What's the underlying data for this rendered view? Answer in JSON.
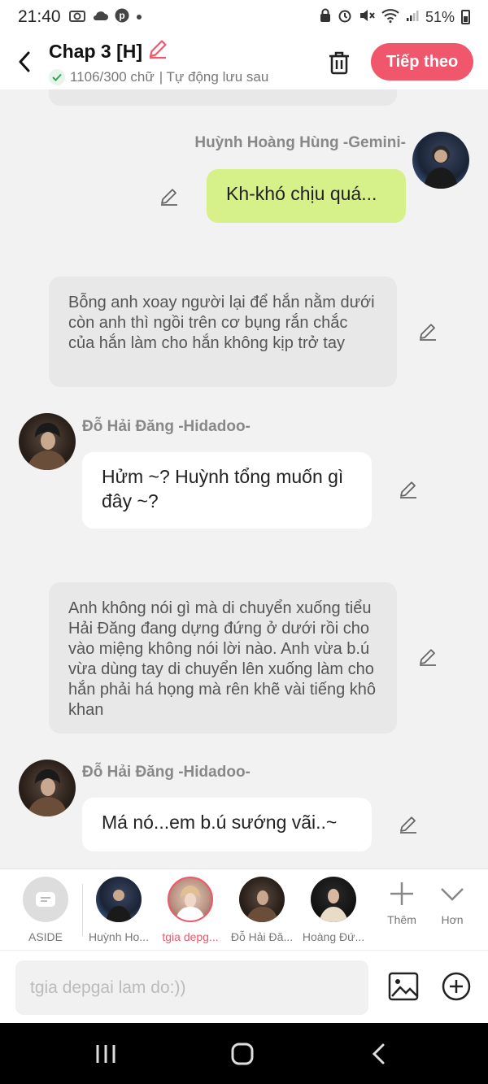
{
  "status_bar": {
    "time": "21:40",
    "battery": "51%"
  },
  "header": {
    "title": "Chap 3 [H]",
    "word_count": "1106/300 chữ",
    "autosave": "| Tự động lưu sau",
    "next_label": "Tiếp theo"
  },
  "messages": [
    {
      "type": "me",
      "name": "Huỳnh Hoàng Hùng -Gemini-",
      "text": "Kh-khó chịu quá..."
    },
    {
      "type": "narration",
      "text": "Bỗng anh xoay người lại để hắn nằm dưới còn anh thì ngồi trên cơ bụng rắn chắc của hắn làm cho hắn không kịp trở tay"
    },
    {
      "type": "other",
      "name": "Đỗ Hải Đăng -Hidadoo-",
      "text": "Hửm ~? Huỳnh tổng muốn gì đây ~?"
    },
    {
      "type": "narration",
      "text": "Anh không nói gì mà di chuyển xuống tiểu Hải Đăng đang dựng đứng ở dưới rồi cho vào miệng không nói lời nào. Anh vừa b.ú vừa dùng tay di chuyển lên xuống làm cho hắn phải há họng mà rên khẽ vài tiếng khô khan"
    },
    {
      "type": "other",
      "name": "Đỗ Hải Đăng -Hidadoo-",
      "text": "Má nó...em b.ú sướng vãi..~"
    }
  ],
  "characters": [
    {
      "label": "ASIDE"
    },
    {
      "label": "Huỳnh Ho..."
    },
    {
      "label": "tgia depg..."
    },
    {
      "label": "Đỗ Hải Đă..."
    },
    {
      "label": "Hoàng Đứ..."
    }
  ],
  "tools": {
    "more_label": "Thêm",
    "less_label": "Hơn"
  },
  "input": {
    "placeholder": "tgia depgai lam do:))"
  },
  "colors": {
    "accent": "#f0566c",
    "my_bubble": "#d6f08a",
    "narration_bubble": "#e8e8e8"
  }
}
